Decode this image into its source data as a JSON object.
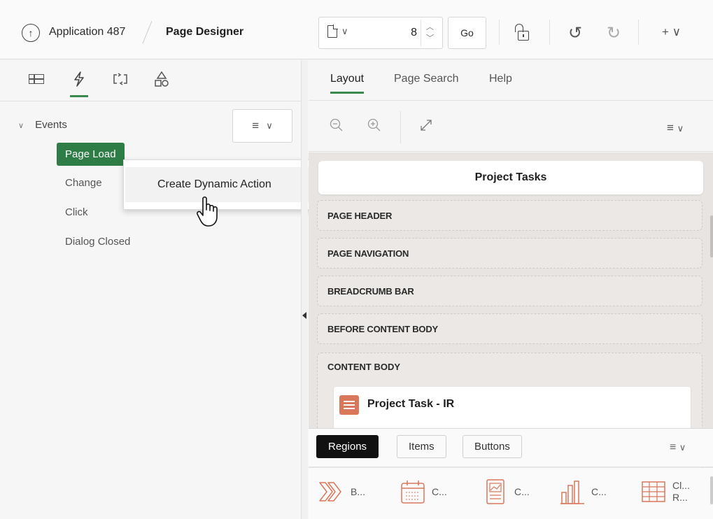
{
  "header": {
    "app_name": "Application 487",
    "page_designer": "Page Designer",
    "page_number": "8",
    "go_label": "Go",
    "plus_label": "+ ∨",
    "icons": [
      "up-arrow-icon",
      "page-icon",
      "lock-icon",
      "undo-icon",
      "redo-icon",
      "plus-icon"
    ]
  },
  "left_panel": {
    "tabs": [
      "rendering",
      "dynamic-actions",
      "processing",
      "shared-components"
    ],
    "events_label": "Events",
    "tree_items": [
      "Page Load",
      "Change",
      "Click",
      "Dialog Closed"
    ],
    "context_menu_item": "Create Dynamic Action"
  },
  "right_panel": {
    "tabs": [
      "Layout",
      "Page Search",
      "Help"
    ],
    "page_title": "Project Tasks",
    "slots": [
      "PAGE HEADER",
      "PAGE NAVIGATION",
      "BREADCRUMB BAR",
      "BEFORE CONTENT BODY"
    ],
    "content_body_label": "CONTENT BODY",
    "region_title": "Project Task - IR",
    "gallery_tabs": [
      "Regions",
      "Items",
      "Buttons"
    ],
    "gallery_items": [
      {
        "icon": "breadcrumb-icon",
        "label": "B..."
      },
      {
        "icon": "calendar-icon",
        "label": "C..."
      },
      {
        "icon": "chart-card-icon",
        "label": "C..."
      },
      {
        "icon": "bar-chart-icon",
        "label": "C..."
      },
      {
        "icon": "classic-report-icon",
        "label": "Cl... R..."
      }
    ]
  },
  "colors": {
    "accent_green": "#2f7d46",
    "ir_icon_orange": "#d9775a"
  }
}
